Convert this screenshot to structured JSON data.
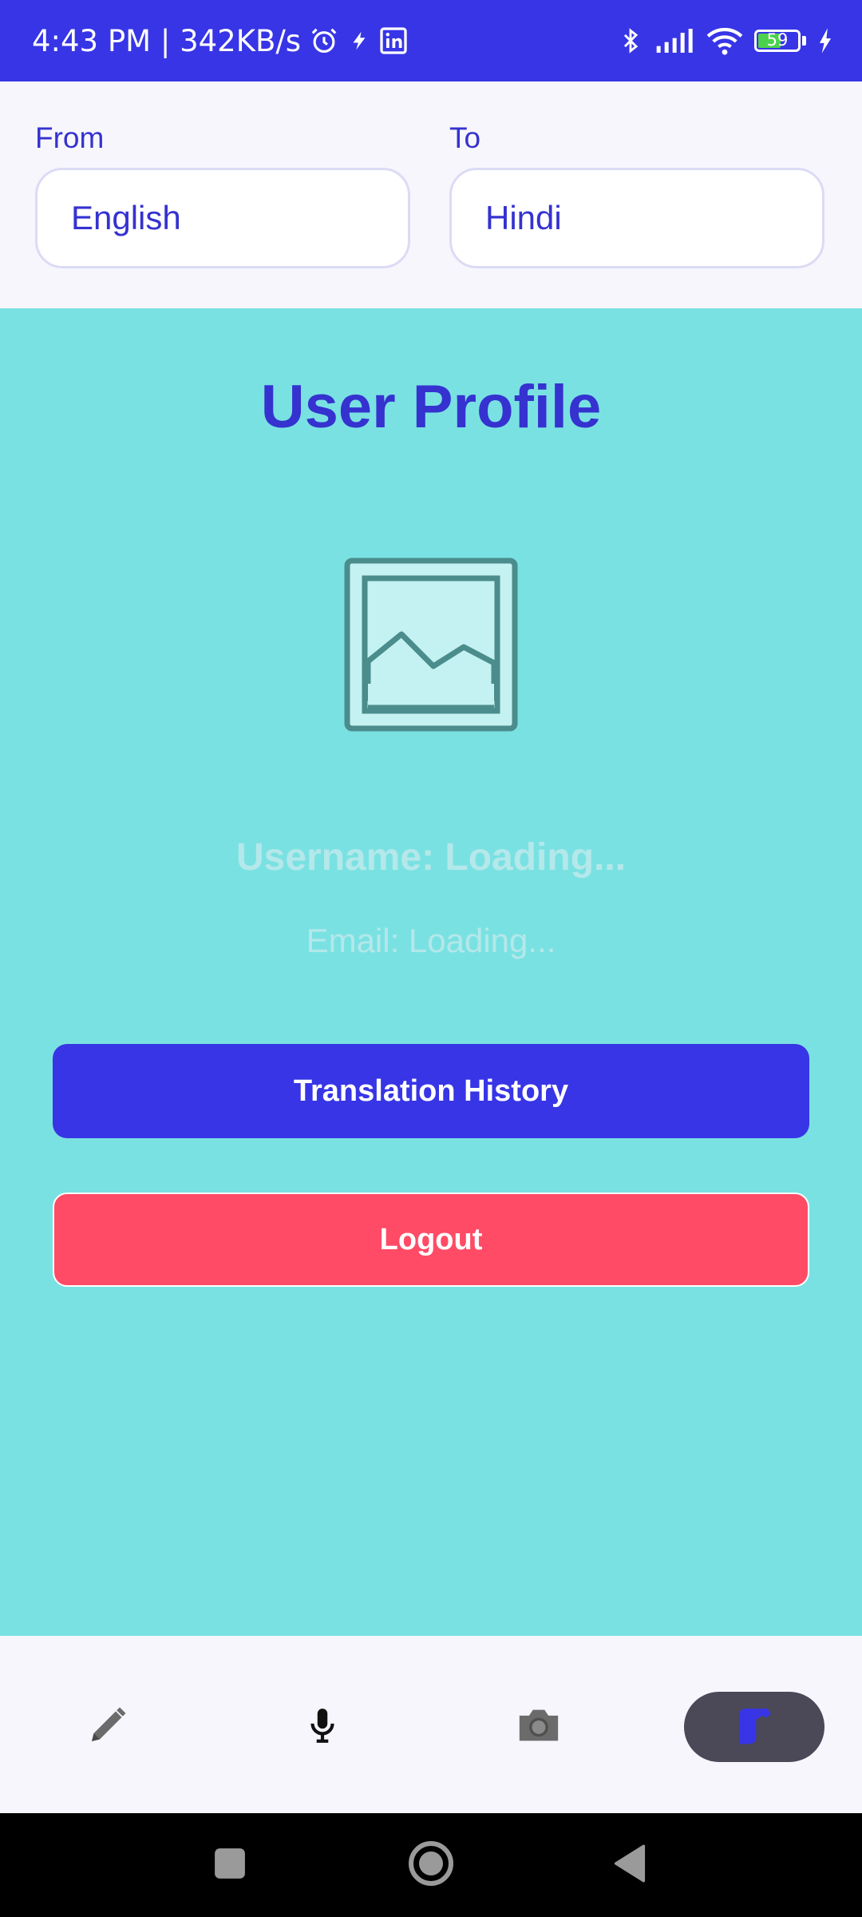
{
  "status_bar": {
    "time_speed": "4:43 PM | 342KB/s",
    "battery_level": "59",
    "battery_fraction": 0.59,
    "icons": [
      "alarm-icon",
      "flash-icon",
      "linkedin-icon",
      "bluetooth-icon",
      "signal-icon",
      "wifi-icon",
      "battery-icon",
      "charging-icon"
    ]
  },
  "language": {
    "from_label": "From",
    "from_value": "English",
    "to_label": "To",
    "to_value": "Hindi"
  },
  "profile": {
    "title": "User Profile",
    "avatar_icon": "image-placeholder-icon",
    "username": "Username: Loading...",
    "email": "Email: Loading..."
  },
  "actions": {
    "history_label": "Translation History",
    "logout_label": "Logout"
  },
  "bottom_nav": {
    "items": [
      {
        "icon": "pencil-icon",
        "active": false
      },
      {
        "icon": "microphone-icon",
        "active": false
      },
      {
        "icon": "camera-icon",
        "active": false
      },
      {
        "icon": "profile-icon",
        "active": true
      }
    ]
  },
  "system_nav": [
    "recents-button",
    "home-button",
    "back-button"
  ],
  "colors": {
    "primary": "#3735e6",
    "background_main": "#7ae1e2",
    "logout": "#ff4b65",
    "surface": "#f7f6fc"
  }
}
